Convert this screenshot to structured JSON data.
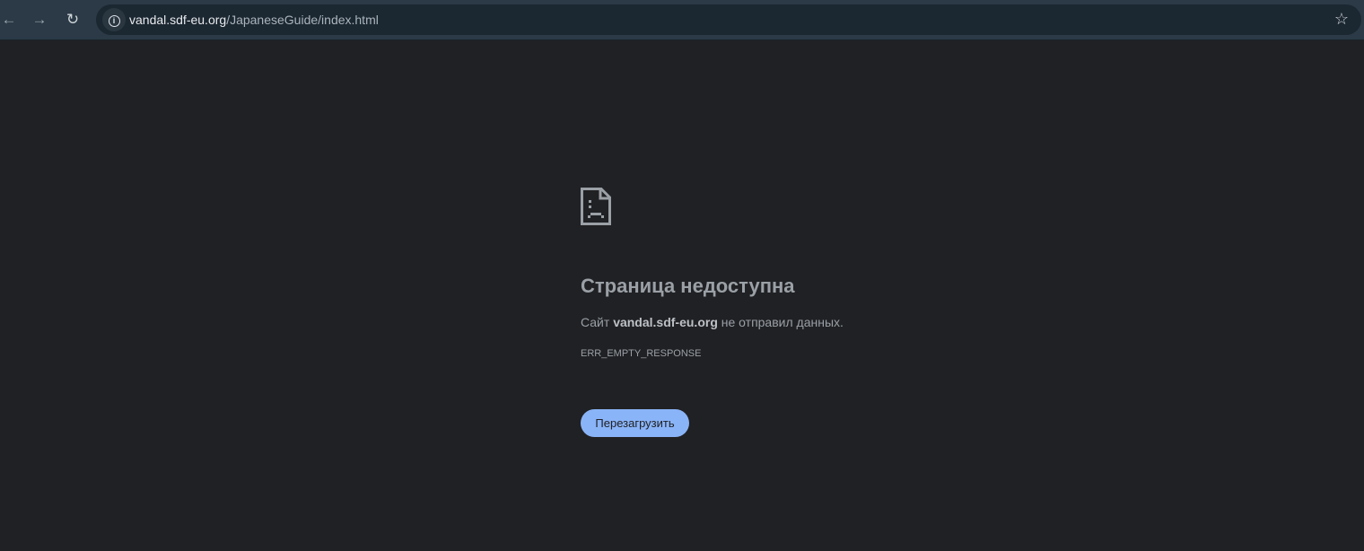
{
  "browser": {
    "url_host": "vandal.sdf-eu.org",
    "url_path": "/JapaneseGuide/index.html"
  },
  "error": {
    "title": "Страница недоступна",
    "msg_prefix": "Сайт ",
    "msg_host": "vandal.sdf-eu.org",
    "msg_suffix": " не отправил данных.",
    "code": "ERR_EMPTY_RESPONSE",
    "reload_label": "Перезагрузить"
  }
}
